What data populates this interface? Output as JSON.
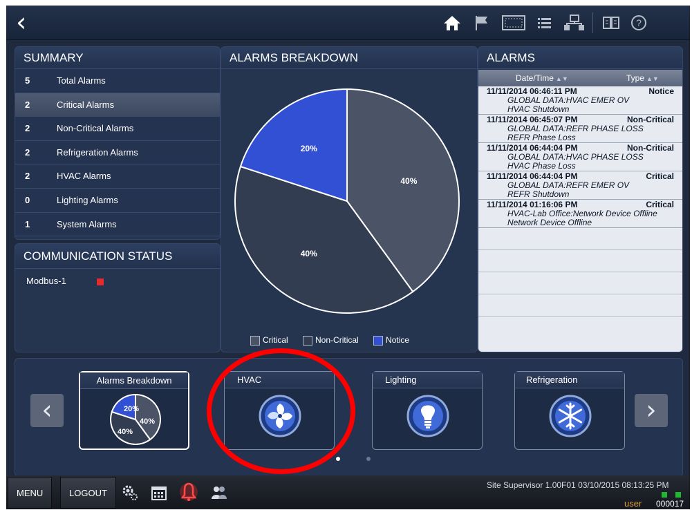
{
  "topbar": {
    "back_icon": "chevron-left-icon",
    "icons": [
      "home-icon",
      "flag-icon",
      "display-icon",
      "list-icon",
      "network-icon",
      "book-icon",
      "help-icon"
    ]
  },
  "summary": {
    "title": "SUMMARY",
    "rows": [
      {
        "count": "5",
        "label": "Total Alarms"
      },
      {
        "count": "2",
        "label": "Critical Alarms"
      },
      {
        "count": "2",
        "label": "Non-Critical Alarms"
      },
      {
        "count": "2",
        "label": "Refrigeration Alarms"
      },
      {
        "count": "2",
        "label": "HVAC Alarms"
      },
      {
        "count": "0",
        "label": "Lighting Alarms"
      },
      {
        "count": "1",
        "label": "System Alarms"
      }
    ],
    "selected_index": 1
  },
  "communication": {
    "title": "COMMUNICATION STATUS",
    "device": "Modbus-1",
    "status_color": "#e52b2b"
  },
  "breakdown": {
    "title": "ALARMS BREAKDOWN",
    "legend": [
      "Critical",
      "Non-Critical",
      "Notice"
    ]
  },
  "chart_data": {
    "type": "pie",
    "labels": [
      "Critical",
      "Non-Critical",
      "Notice"
    ],
    "values": [
      40,
      40,
      20
    ],
    "value_labels": [
      "40%",
      "40%",
      "20%"
    ],
    "colors": [
      "#4b5467",
      "#333d52",
      "#3250d3"
    ]
  },
  "alarms": {
    "title": "ALARMS",
    "columns": {
      "date": "Date/Time",
      "type": "Type"
    },
    "rows": [
      {
        "datetime": "11/11/2014 06:46:11 PM",
        "type": "Notice",
        "line1": "GLOBAL DATA:HVAC EMER OV",
        "line2": "HVAC Shutdown"
      },
      {
        "datetime": "11/11/2014 06:45:07 PM",
        "type": "Non-Critical",
        "line1": "GLOBAL DATA:REFR PHASE LOSS",
        "line2": "REFR Phase Loss"
      },
      {
        "datetime": "11/11/2014 06:44:04 PM",
        "type": "Non-Critical",
        "line1": "GLOBAL DATA:HVAC PHASE LOSS",
        "line2": "HVAC Phase Loss"
      },
      {
        "datetime": "11/11/2014 06:44:04 PM",
        "type": "Critical",
        "line1": "GLOBAL DATA:REFR EMER OV",
        "line2": "REFR Shutdown"
      },
      {
        "datetime": "11/11/2014 01:16:06 PM",
        "type": "Critical",
        "line1": "HVAC-Lab Office:Network Device Offline",
        "line2": "Network Device Offline"
      }
    ]
  },
  "carousel": {
    "tiles": [
      {
        "title": "Alarms Breakdown",
        "icon": "pie-chart-icon",
        "labels": [
          "20%",
          "40%",
          "40%"
        ]
      },
      {
        "title": "HVAC",
        "icon": "hvac-fan-icon"
      },
      {
        "title": "Lighting",
        "icon": "light-bulb-icon"
      },
      {
        "title": "Refrigeration",
        "icon": "snowflake-icon"
      }
    ],
    "page_count": 2,
    "current_page": 1
  },
  "bottombar": {
    "menu": "MENU",
    "logout": "LOGOUT",
    "icons": [
      "settings-icon",
      "calendar-icon",
      "alarm-bell-icon",
      "users-icon"
    ],
    "site_info": "Site Supervisor 1.00F01 03/10/2015 08:13:25 PM",
    "user": "user",
    "user_code": "000017"
  },
  "colors": {
    "annotation": "#ff0000",
    "alarm_active": "#e52b2b",
    "led": "#23b534"
  }
}
